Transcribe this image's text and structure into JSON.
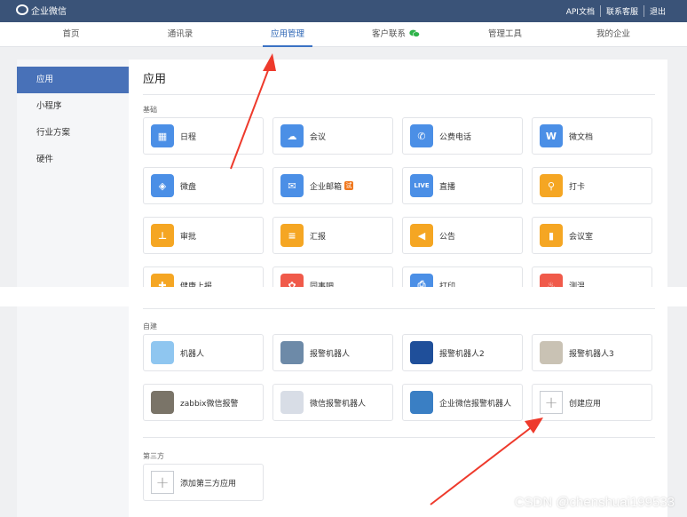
{
  "header": {
    "logo_text": "企业微信",
    "links": [
      "API文档",
      "联系客服",
      "退出"
    ]
  },
  "nav": {
    "items": [
      "首页",
      "通讯录",
      "应用管理",
      "客户联系",
      "管理工具",
      "我的企业"
    ],
    "active": "应用管理"
  },
  "sidebar": {
    "items": [
      "应用",
      "小程序",
      "行业方案",
      "硬件"
    ],
    "active": "应用"
  },
  "main": {
    "title": "应用",
    "basic": {
      "label": "基础",
      "apps": [
        {
          "name": "日程",
          "icon": "calendar-icon",
          "color": "#4b8fe6",
          "glyph": "▦"
        },
        {
          "name": "会议",
          "icon": "cloud-meeting-icon",
          "color": "#4b8fe6",
          "glyph": "☁"
        },
        {
          "name": "公费电话",
          "icon": "phone-icon",
          "color": "#4b8fe6",
          "glyph": "✆"
        },
        {
          "name": "微文档",
          "icon": "doc-w-icon",
          "color": "#4b8fe6",
          "glyph": "W"
        },
        {
          "name": "微盘",
          "icon": "drive-icon",
          "color": "#4b8fe6",
          "glyph": "◈"
        },
        {
          "name": "企业邮箱",
          "icon": "mail-icon",
          "color": "#4b8fe6",
          "glyph": "✉",
          "badge": "试"
        },
        {
          "name": "直播",
          "icon": "live-icon",
          "color": "#4b8fe6",
          "glyph": "LIVE"
        },
        {
          "name": "打卡",
          "icon": "location-icon",
          "color": "#f5a623",
          "glyph": "⚲"
        },
        {
          "name": "审批",
          "icon": "stamp-icon",
          "color": "#f5a623",
          "glyph": "⊥"
        },
        {
          "name": "汇报",
          "icon": "report-icon",
          "color": "#f5a623",
          "glyph": "≡"
        },
        {
          "name": "公告",
          "icon": "announcement-icon",
          "color": "#f5a623",
          "glyph": "◀"
        },
        {
          "name": "会议室",
          "icon": "meeting-room-icon",
          "color": "#f5a623",
          "glyph": "▮"
        },
        {
          "name": "健康上报",
          "icon": "health-icon",
          "color": "#f5a623",
          "glyph": "✚"
        },
        {
          "name": "同事吧",
          "icon": "colleague-icon",
          "color": "#f05a4a",
          "glyph": "✿"
        },
        {
          "name": "打印",
          "icon": "print-icon",
          "color": "#4b8fe6",
          "glyph": "⎙"
        },
        {
          "name": "测温",
          "icon": "thermometer-icon",
          "color": "#f05a4a",
          "glyph": "♨"
        }
      ]
    },
    "custom": {
      "label": "自建",
      "apps": [
        {
          "name": "机器人",
          "icon": "robot-icon",
          "color": "#8fc6f0"
        },
        {
          "name": "报警机器人",
          "icon": "landscape-thumb-icon",
          "color": "#6d8aa8"
        },
        {
          "name": "报警机器人2",
          "icon": "windows-thumb-icon",
          "color": "#1f4f9a"
        },
        {
          "name": "报警机器人3",
          "icon": "sketch-thumb-icon",
          "color": "#c9c2b4"
        },
        {
          "name": "zabbix微信报警",
          "icon": "koala-thumb-icon",
          "color": "#7a7468"
        },
        {
          "name": "微信报警机器人",
          "icon": "screenshot-thumb-icon",
          "color": "#d8dde6"
        },
        {
          "name": "企业微信报警机器人",
          "icon": "wework-thumb-icon",
          "color": "#3a7fc4"
        },
        {
          "name": "创建应用",
          "icon": "plus-icon",
          "color": "#ffffff"
        }
      ]
    },
    "third_party": {
      "label": "第三方",
      "add_label": "添加第三方应用"
    }
  },
  "watermark": "CSDN @chenshuai199533"
}
